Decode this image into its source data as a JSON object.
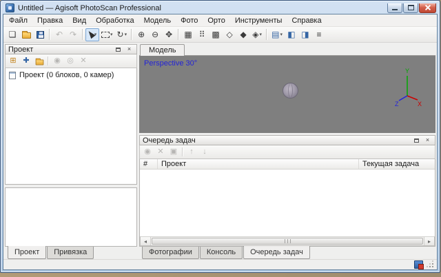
{
  "window": {
    "title": "Untitled — Agisoft PhotoScan Professional"
  },
  "colors": {
    "titlebar": "#c8daee",
    "viewport_bg": "#7f7f7f",
    "perspective_label": "#2323d7",
    "axis_x": "#cc0000",
    "axis_y": "#00a800",
    "axis_z": "#2222dd",
    "accent_blue": "#3465a4",
    "close_button": "#bf4632"
  },
  "icons": {
    "dropdown": "▾",
    "close": "×",
    "scroll_left": "◂",
    "scroll_right": "▸"
  },
  "menubar": {
    "items": [
      "Файл",
      "Правка",
      "Вид",
      "Обработка",
      "Модель",
      "Фото",
      "Орто",
      "Инструменты",
      "Справка"
    ]
  },
  "toolbar": {
    "buttons": [
      {
        "name": "new-project-icon",
        "glyph": "❏"
      },
      {
        "name": "open-project-icon",
        "glyph": ""
      },
      {
        "name": "save-project-icon",
        "glyph": ""
      },
      {
        "name": "undo-icon",
        "glyph": "↶",
        "disabled": true
      },
      {
        "name": "redo-icon",
        "glyph": "↷",
        "disabled": true
      },
      {
        "name": "navigation-tool-icon",
        "glyph": "",
        "pressed": true,
        "dropdown": true
      },
      {
        "name": "selection-tool-icon",
        "glyph": "",
        "dropdown": true
      },
      {
        "name": "rotate-tool-icon",
        "glyph": "↻",
        "dropdown": true
      },
      {
        "name": "zoom-in-icon",
        "glyph": "⊕"
      },
      {
        "name": "zoom-out-icon",
        "glyph": "⊖"
      },
      {
        "name": "reset-view-icon",
        "glyph": "✥"
      },
      {
        "name": "show-cameras-icon",
        "glyph": "▦"
      },
      {
        "name": "point-cloud-icon",
        "glyph": "⠿"
      },
      {
        "name": "dense-cloud-icon",
        "glyph": "▩"
      },
      {
        "name": "mesh-wireframe-icon",
        "glyph": "◇"
      },
      {
        "name": "mesh-solid-icon",
        "glyph": "◆"
      },
      {
        "name": "mesh-shaded-icon",
        "glyph": "◈",
        "dropdown": true
      },
      {
        "name": "photos-pane-icon",
        "glyph": "▤",
        "dropdown": true
      },
      {
        "name": "workspace-pane-icon",
        "glyph": "◧"
      },
      {
        "name": "console-pane-icon",
        "glyph": "◨"
      },
      {
        "name": "preferences-icon",
        "glyph": "≡"
      }
    ]
  },
  "project_panel": {
    "title": "Проект",
    "buttons": [
      {
        "name": "add-chunk-icon",
        "glyph": "⊞"
      },
      {
        "name": "add-photos-icon",
        "glyph": "✚"
      },
      {
        "name": "add-folder-icon",
        "glyph": ""
      },
      {
        "name": "enable-item-icon",
        "glyph": "◉",
        "disabled": true
      },
      {
        "name": "disable-item-icon",
        "glyph": "◎",
        "disabled": true
      },
      {
        "name": "remove-item-icon",
        "glyph": "✕",
        "disabled": true
      }
    ],
    "tree_root": "Проект (0 блоков, 0 камер)",
    "tabs": [
      "Проект",
      "Привязка"
    ],
    "active_tab": "Проект"
  },
  "model_view": {
    "tab": "Модель",
    "perspective_label": "Perspective 30°",
    "axes": {
      "x": "X",
      "y": "Y",
      "z": "Z"
    }
  },
  "task_queue": {
    "title": "Очередь задач",
    "buttons": [
      {
        "name": "run-tasks-icon",
        "glyph": "◉",
        "disabled": true
      },
      {
        "name": "cancel-task-icon",
        "glyph": "✕",
        "disabled": true
      },
      {
        "name": "clear-tasks-icon",
        "glyph": "▣",
        "disabled": true
      },
      {
        "name": "move-up-icon",
        "glyph": "↑",
        "disabled": true
      },
      {
        "name": "move-down-icon",
        "glyph": "↓",
        "disabled": true
      }
    ],
    "columns": [
      "#",
      "Проект",
      "Текущая задача"
    ],
    "rows": [],
    "tabs": [
      "Фотографии",
      "Консоль",
      "Очередь задач"
    ],
    "active_tab": "Очередь задач"
  }
}
